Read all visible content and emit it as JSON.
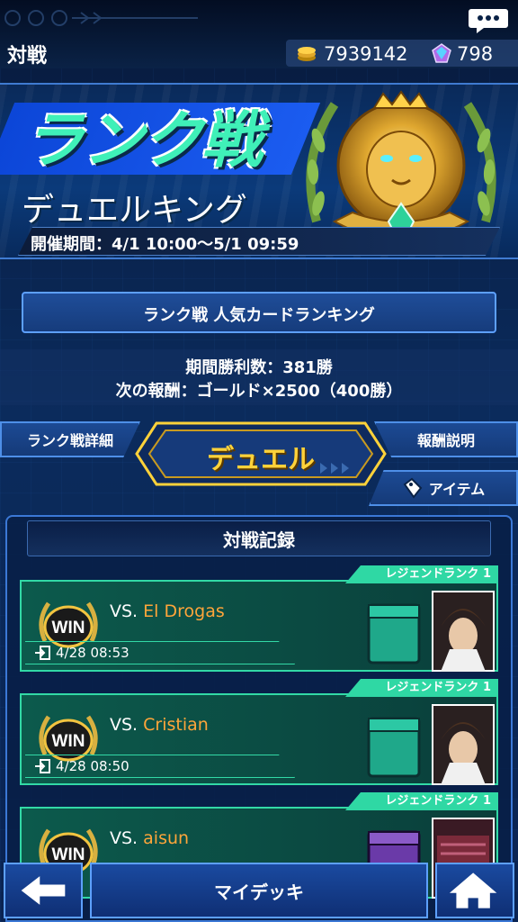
{
  "header": {
    "title": "対戦",
    "gold": "7939142",
    "gems": "798"
  },
  "banner": {
    "title": "ランク戦",
    "subtitle": "デュエルキング",
    "period": "開催期間：4/1 10:00〜5/1 09:59"
  },
  "popular_ranking_label": "ランク戦 人気カードランキング",
  "stats": {
    "wins_line": "期間勝利数：381勝",
    "next_reward_line": "次の報酬：ゴールド×2500（400勝）"
  },
  "actions": {
    "rank_detail": "ランク戦詳細",
    "duel": "デュエル",
    "reward_explanation": "報酬説明",
    "item": "アイテム"
  },
  "records": {
    "title": "対戦記録",
    "items": [
      {
        "rank": "レジェンドランク 1",
        "result": "WIN",
        "vs": "VS.",
        "opponent": "El Drogas",
        "time": "4/28 08:53",
        "deck_color": "#1fa88a"
      },
      {
        "rank": "レジェンドランク 1",
        "result": "WIN",
        "vs": "VS.",
        "opponent": "Cristian",
        "time": "4/28 08:50",
        "deck_color": "#1fa88a"
      },
      {
        "rank": "レジェンドランク 1",
        "result": "WIN",
        "vs": "VS.",
        "opponent": "aisun",
        "time": "",
        "deck_color": "#6a3aa8"
      }
    ]
  },
  "bottom": {
    "my_deck": "マイデッキ"
  },
  "colors": {
    "accent_green": "#32d9a6",
    "gold_text": "#ffd23a",
    "opponent_orange": "#ffa53a"
  }
}
